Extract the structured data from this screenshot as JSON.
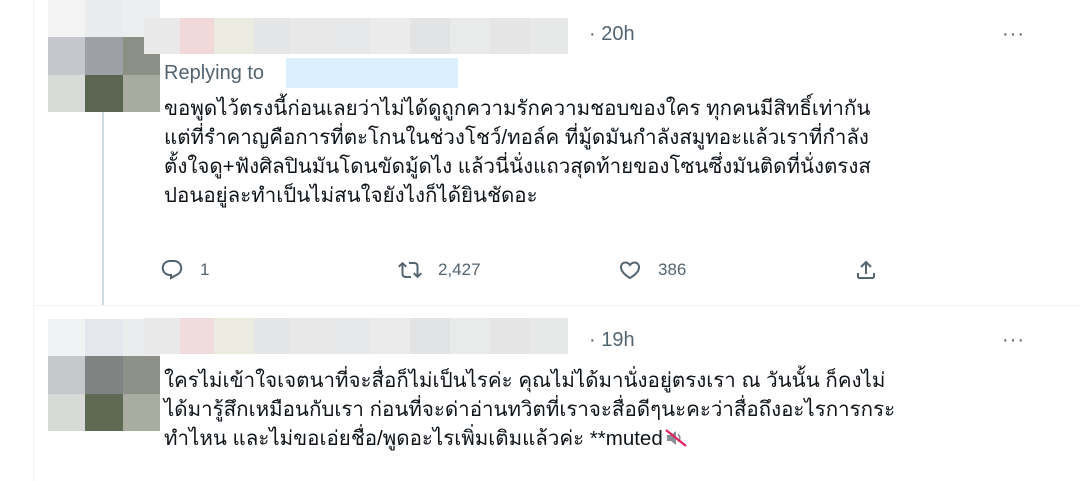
{
  "tweets": [
    {
      "timestamp": "· 20h",
      "more": "···",
      "replying_label": "Replying to",
      "text": "ขอพูดไว้ตรงนี้ก่อนเลยว่าไม่ได้ดูถูกความรักความชอบของใคร ทุกคนมีสิทธิ์เท่ากัน\nแต่ที่รำคาญคือการที่ตะโกนในช่วงโชว์/ทอล์ค ที่มู้ดมันกำลังสมูทอะแล้วเราที่กำลัง\nตั้งใจดู+ฟังศิลปินมันโดนขัดมู้ดไง แล้วนี่นั่งแถวสุดท้ายของโซนซึ่งมันติดที่นั่งตรงส\nปอนอยู่ละทำเป็นไม่สนใจยังไงก็ได้ยินชัดอะ",
      "actions": {
        "reply_count": "1",
        "retweet_count": "2,427",
        "like_count": "386"
      },
      "icons": {
        "reply": "reply-icon",
        "retweet": "retweet-icon",
        "like": "like-icon",
        "share": "share-icon"
      }
    },
    {
      "timestamp": "· 19h",
      "more": "···",
      "text": "ใครไม่เข้าใจเจตนาที่จะสื่อก็ไม่เป็นไรค่ะ คุณไม่ได้มานั่งอยู่ตรงเรา ณ วันนั้น ก็คงไม่\nได้มารู้สึกเหมือนกับเรา ก่อนที่จะด่าอ่านทวิตที่เราจะสื่อดีๆนะคะว่าสื่อถึงอะไรการกระ\nทำไหน และไม่ขอเอ่ยชื่อ/พูดอะไรเพิ่มเติมแล้วค่ะ **muted",
      "icons": {
        "trailing": "muted-speaker-icon"
      }
    }
  ],
  "colors": {
    "text_primary": "#0f1419",
    "text_secondary": "#536471",
    "thread_line": "#cfd9de",
    "divider": "#eff3f4",
    "handle_redaction": "#dcefff"
  }
}
